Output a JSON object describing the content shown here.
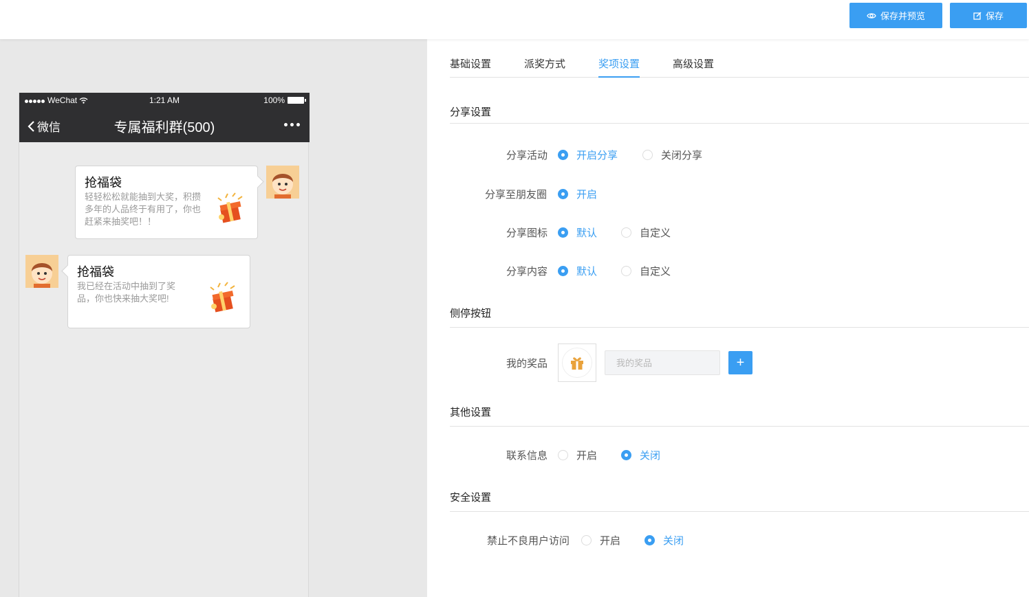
{
  "toolbar": {
    "preview_save_label": "保存并预览",
    "save_label": "保存",
    "accent_color": "#3a9ef2"
  },
  "phone": {
    "carrier": "WeChat",
    "time": "1:21 AM",
    "battery": "100%",
    "back_label": "微信",
    "chat_title": "专属福利群(500)",
    "messages": [
      {
        "side": "right",
        "title": "抢福袋",
        "desc": "轻轻松松就能抽到大奖，积攒多年的人品终于有用了，你也赶紧来抽奖吧！！"
      },
      {
        "side": "left",
        "title": "抢福袋",
        "desc": "我已经在活动中抽到了奖品，你也快来抽大奖吧!"
      }
    ]
  },
  "tabs": [
    {
      "label": "基础设置",
      "active": false
    },
    {
      "label": "派奖方式",
      "active": false
    },
    {
      "label": "奖项设置",
      "active": false
    },
    {
      "label": "高级设置",
      "active": true
    }
  ],
  "share": {
    "title": "分享设置",
    "activity_label": "分享活动",
    "activity_on": "开启分享",
    "activity_off": "关闭分享",
    "moments_label": "分享至朋友圈",
    "moments_on": "开启",
    "icon_label": "分享图标",
    "icon_default": "默认",
    "icon_custom": "自定义",
    "content_label": "分享内容",
    "content_default": "默认",
    "content_custom": "自定义"
  },
  "side_button": {
    "title": "侧停按钮",
    "prize_label": "我的奖品",
    "prize_placeholder": "我的奖品",
    "add_label": "+"
  },
  "other": {
    "title": "其他设置",
    "contact_label": "联系信息",
    "on": "开启",
    "off": "关闭"
  },
  "security": {
    "title": "安全设置",
    "block_label": "禁止不良用户访问",
    "on": "开启",
    "off": "关闭"
  }
}
